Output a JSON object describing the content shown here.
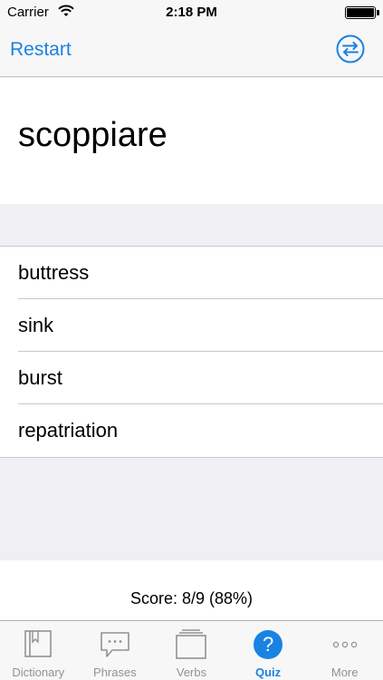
{
  "status": {
    "carrier": "Carrier",
    "time": "2:18 PM"
  },
  "nav": {
    "restart_label": "Restart",
    "swap_icon": "swap-arrows-icon"
  },
  "quiz": {
    "word": "scoppiare",
    "answers": [
      "buttress",
      "sink",
      "burst",
      "repatriation"
    ],
    "score": "Score: 8/9 (88%)"
  },
  "tabs": [
    {
      "label": "Dictionary",
      "icon": "book-icon"
    },
    {
      "label": "Phrases",
      "icon": "speech-bubble-icon"
    },
    {
      "label": "Verbs",
      "icon": "cards-icon"
    },
    {
      "label": "Quiz",
      "icon": "question-icon",
      "glyph": "?",
      "active": true
    },
    {
      "label": "More",
      "icon": "more-dots-icon"
    }
  ],
  "colors": {
    "accent": "#1a82e2",
    "inactive": "#929292",
    "background": "#efeff4"
  }
}
